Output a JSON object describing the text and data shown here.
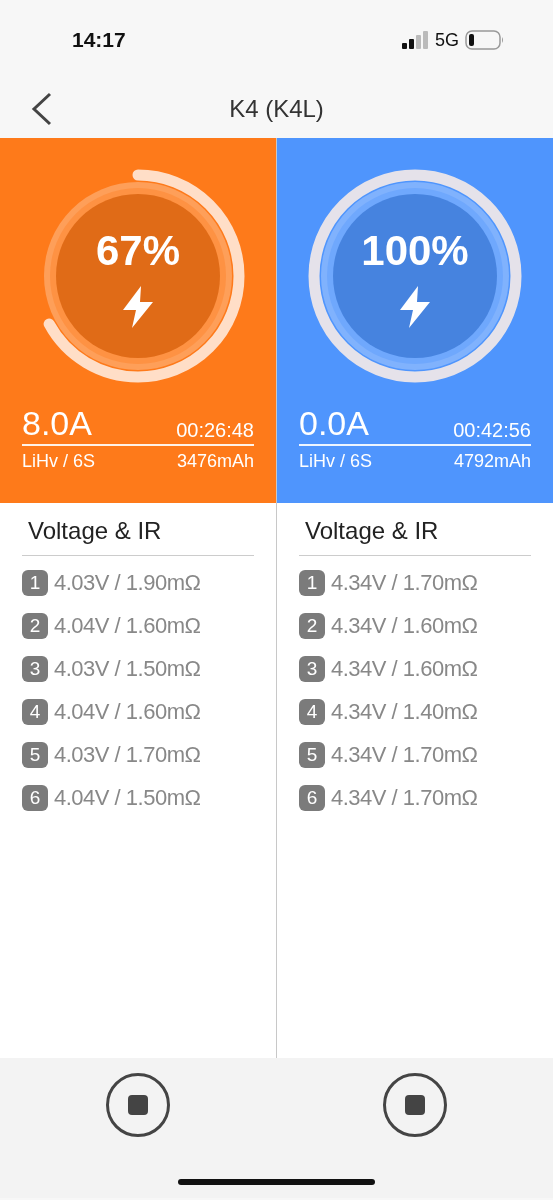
{
  "status_bar": {
    "time": "14:17",
    "network": "5G"
  },
  "nav": {
    "title": "K4 (K4L)"
  },
  "channels": [
    {
      "color": "#fe7a1a",
      "level": 0.67,
      "percent": "67%",
      "current": "8.0A",
      "elapsed": "00:26:48",
      "battery": "LiHv / 6S",
      "capacity": "3476mAh",
      "section_title": "Voltage & IR",
      "cells": [
        {
          "index": "1",
          "reading": "4.03V / 1.90mΩ"
        },
        {
          "index": "2",
          "reading": "4.04V / 1.60mΩ"
        },
        {
          "index": "3",
          "reading": "4.03V / 1.50mΩ"
        },
        {
          "index": "4",
          "reading": "4.04V / 1.60mΩ"
        },
        {
          "index": "5",
          "reading": "4.03V / 1.70mΩ"
        },
        {
          "index": "6",
          "reading": "4.04V / 1.50mΩ"
        }
      ]
    },
    {
      "color": "#4f95fd",
      "level": 1.0,
      "percent": "100%",
      "current": "0.0A",
      "elapsed": "00:42:56",
      "battery": "LiHv / 6S",
      "capacity": "4792mAh",
      "section_title": "Voltage & IR",
      "cells": [
        {
          "index": "1",
          "reading": "4.34V / 1.70mΩ"
        },
        {
          "index": "2",
          "reading": "4.34V / 1.60mΩ"
        },
        {
          "index": "3",
          "reading": "4.34V / 1.60mΩ"
        },
        {
          "index": "4",
          "reading": "4.34V / 1.40mΩ"
        },
        {
          "index": "5",
          "reading": "4.34V / 1.70mΩ"
        },
        {
          "index": "6",
          "reading": "4.34V / 1.70mΩ"
        }
      ]
    }
  ]
}
